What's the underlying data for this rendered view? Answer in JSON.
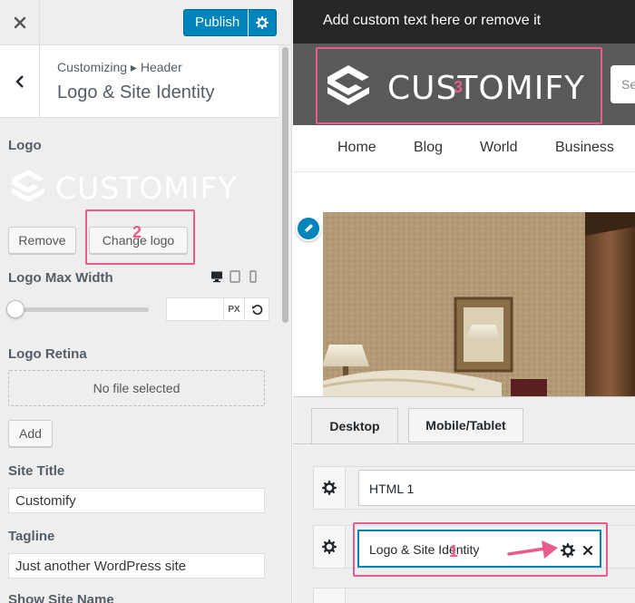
{
  "customizer": {
    "publish_label": "Publish",
    "breadcrumb": "Customizing ▸ Header",
    "section_title": "Logo & Site Identity",
    "logo": {
      "label": "Logo",
      "preview_text": "CUSTOMIFY",
      "remove_label": "Remove",
      "change_label": "Change logo"
    },
    "logo_max_width": {
      "label": "Logo Max Width",
      "value": "",
      "unit": "PX"
    },
    "logo_retina": {
      "label": "Logo Retina",
      "empty_text": "No file selected",
      "add_label": "Add"
    },
    "site_title": {
      "label": "Site Title",
      "value": "Customify"
    },
    "tagline": {
      "label": "Tagline",
      "value": "Just another WordPress site"
    },
    "show_site_name_label": "Show Site Name"
  },
  "preview": {
    "top_text": "Add custom text here or remove it",
    "logo_text": "CUSTOMIFY",
    "search_placeholder": "Se",
    "nav": [
      "Home",
      "Blog",
      "World",
      "Business"
    ]
  },
  "builder": {
    "tabs": [
      "Desktop",
      "Mobile/Tablet"
    ],
    "items": [
      "HTML 1",
      "Logo & Site Identity"
    ]
  },
  "annotations": [
    "1",
    "2",
    "3"
  ],
  "colors": {
    "primary": "#0085ba",
    "annotation": "#e85b8c",
    "topbar_dark": "#262626",
    "header_gray": "#595959"
  }
}
